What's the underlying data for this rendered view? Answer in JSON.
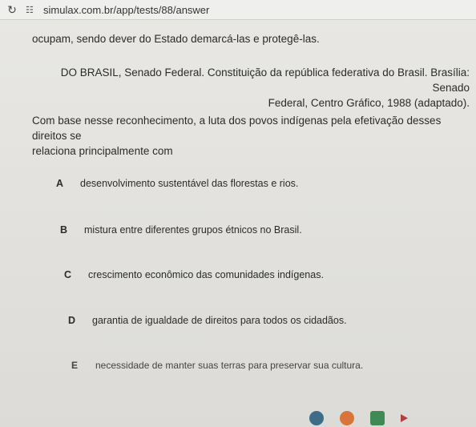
{
  "browser": {
    "reload_icon": "reload-icon",
    "site_info_icon": "site-info-icon",
    "url": "simulax.com.br/app/tests/88/answer"
  },
  "content": {
    "intro": "ocupam, sendo dever do Estado demarcá-las e protegê-las.",
    "citation_line1": "DO BRASIL, Senado Federal. Constituição da república federativa do Brasil. Brasília: Senado",
    "citation_line2": "Federal, Centro Gráfico, 1988 (adaptado).",
    "question_line1": "Com base nesse reconhecimento, a luta dos povos indígenas pela efetivação desses direitos se",
    "question_line2": "relaciona principalmente com"
  },
  "options": [
    {
      "letter": "A",
      "text": "desenvolvimento sustentável das florestas e rios."
    },
    {
      "letter": "B",
      "text": "mistura entre diferentes grupos étnicos no Brasil."
    },
    {
      "letter": "C",
      "text": "crescimento econômico das comunidades indígenas."
    },
    {
      "letter": "D",
      "text": "garantia de igualdade de direitos para todos os cidadãos."
    },
    {
      "letter": "E",
      "text": "necessidade de manter suas terras para preservar sua cultura."
    }
  ]
}
